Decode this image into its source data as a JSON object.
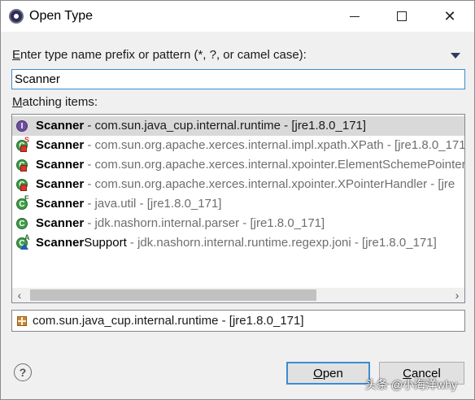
{
  "window": {
    "title": "Open Type",
    "icon": "eclipse-icon"
  },
  "prompt": {
    "accel": "E",
    "label_rest": "nter type name prefix or pattern (*, ?, or camel case):"
  },
  "search": {
    "value": "Scanner",
    "placeholder": ""
  },
  "matching": {
    "accel": "M",
    "label_rest": "atching items:"
  },
  "items": [
    {
      "icon": "interface-icon",
      "badge": "",
      "name": "Scanner",
      "name_rest": "",
      "qualifier": " - com.sun.java_cup.internal.runtime - [jre1.8.0_171]",
      "selected": true
    },
    {
      "icon": "class-icon",
      "badge": "S",
      "name": "Scanner",
      "name_rest": "",
      "qualifier": " - com.sun.org.apache.xerces.internal.impl.xpath.XPath - [jre1.8.0_171]",
      "selected": false
    },
    {
      "icon": "class-icon",
      "badge": "",
      "name": "Scanner",
      "name_rest": "",
      "qualifier": " - com.sun.org.apache.xerces.internal.xpointer.ElementSchemePointer",
      "selected": false
    },
    {
      "icon": "class-icon",
      "badge": "",
      "name": "Scanner",
      "name_rest": "",
      "qualifier": " - com.sun.org.apache.xerces.internal.xpointer.XPointerHandler - [jre",
      "selected": false
    },
    {
      "icon": "class-icon",
      "badge": "F",
      "name": "Scanner",
      "name_rest": "",
      "qualifier": " - java.util - [jre1.8.0_171]",
      "selected": false
    },
    {
      "icon": "class-icon",
      "badge": "",
      "name": "Scanner",
      "name_rest": "",
      "qualifier": " - jdk.nashorn.internal.parser - [jre1.8.0_171]",
      "selected": false
    },
    {
      "icon": "class-icon",
      "badge": "A",
      "name": "Scanner",
      "name_rest": "Support",
      "qualifier": " - jdk.nashorn.internal.runtime.regexp.joni - [jre1.8.0_171]",
      "selected": false
    }
  ],
  "details": {
    "text": "com.sun.java_cup.internal.runtime - [jre1.8.0_171]"
  },
  "buttons": {
    "open_accel": "O",
    "open_rest": "pen",
    "cancel_accel": "C",
    "cancel_rest": "ancel"
  },
  "watermark": "头条 @小海洋why",
  "colors": {
    "selection": "#d9d9d9",
    "focus": "#3c8ccf"
  }
}
